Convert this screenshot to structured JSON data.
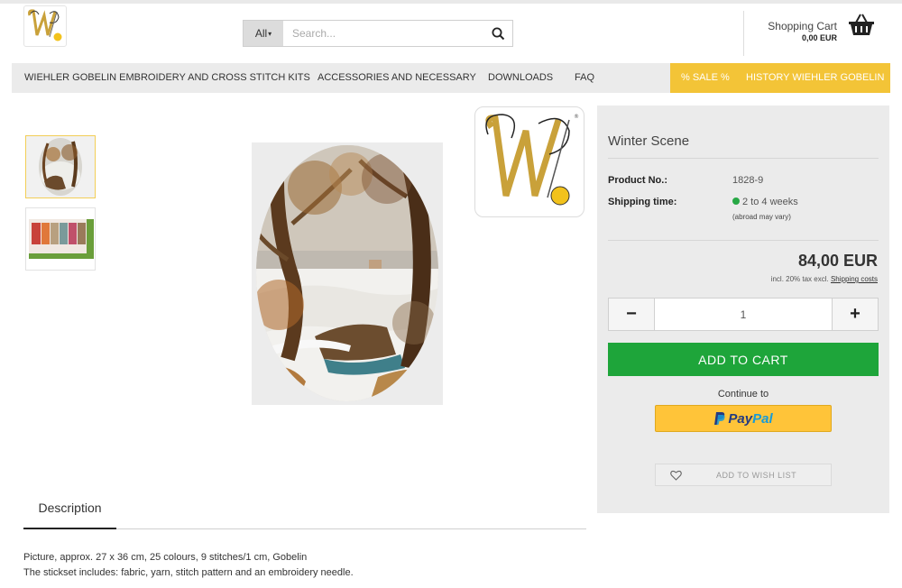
{
  "header": {
    "search_category": "All",
    "search_placeholder": "Search...",
    "cart_label": "Shopping Cart",
    "cart_total": "0,00 EUR"
  },
  "nav": {
    "items": [
      "WIEHLER GOBELIN EMBROIDERY AND CROSS STITCH KITS",
      "ACCESSORIES AND NECESSARY",
      "DOWNLOADS",
      "FAQ"
    ],
    "sale": "% SALE %",
    "history": "HISTORY WIEHLER GOBELIN"
  },
  "product": {
    "title": "Winter Scene",
    "product_no_label": "Product No.:",
    "product_no": "1828-9",
    "shipping_label": "Shipping time:",
    "shipping_value": "2 to 4 weeks",
    "shipping_note": "(abroad may vary)",
    "price": "84,00 EUR",
    "tax_note": "incl. 20% tax excl.",
    "shipping_costs_link": "Shipping costs",
    "quantity": "1",
    "minus": "−",
    "plus": "+",
    "add_to_cart": "ADD TO CART",
    "continue_to": "Continue to",
    "paypal_a": "Pay",
    "paypal_b": "Pal",
    "wishlist": "ADD TO WISH LIST"
  },
  "description": {
    "tab": "Description",
    "line1": "Picture, approx. 27 x 36 cm, 25 colours, 9 stitches/1 cm, Gobelin",
    "line2": "The stickset includes: fabric, yarn, stitch pattern and an embroidery needle."
  },
  "colors": {
    "nav_bg": "#ebebeb",
    "sale_bg": "#f3c437",
    "add_to_cart": "#1ea53a",
    "panel_bg": "#ebebeb",
    "paypal_bg": "#ffc439",
    "stock_dot": "#27a845"
  },
  "icons": {
    "search": "search-icon",
    "cart": "shopping-basket-icon",
    "heart": "heart-icon",
    "paypal_mark": "paypal-p-icon"
  }
}
